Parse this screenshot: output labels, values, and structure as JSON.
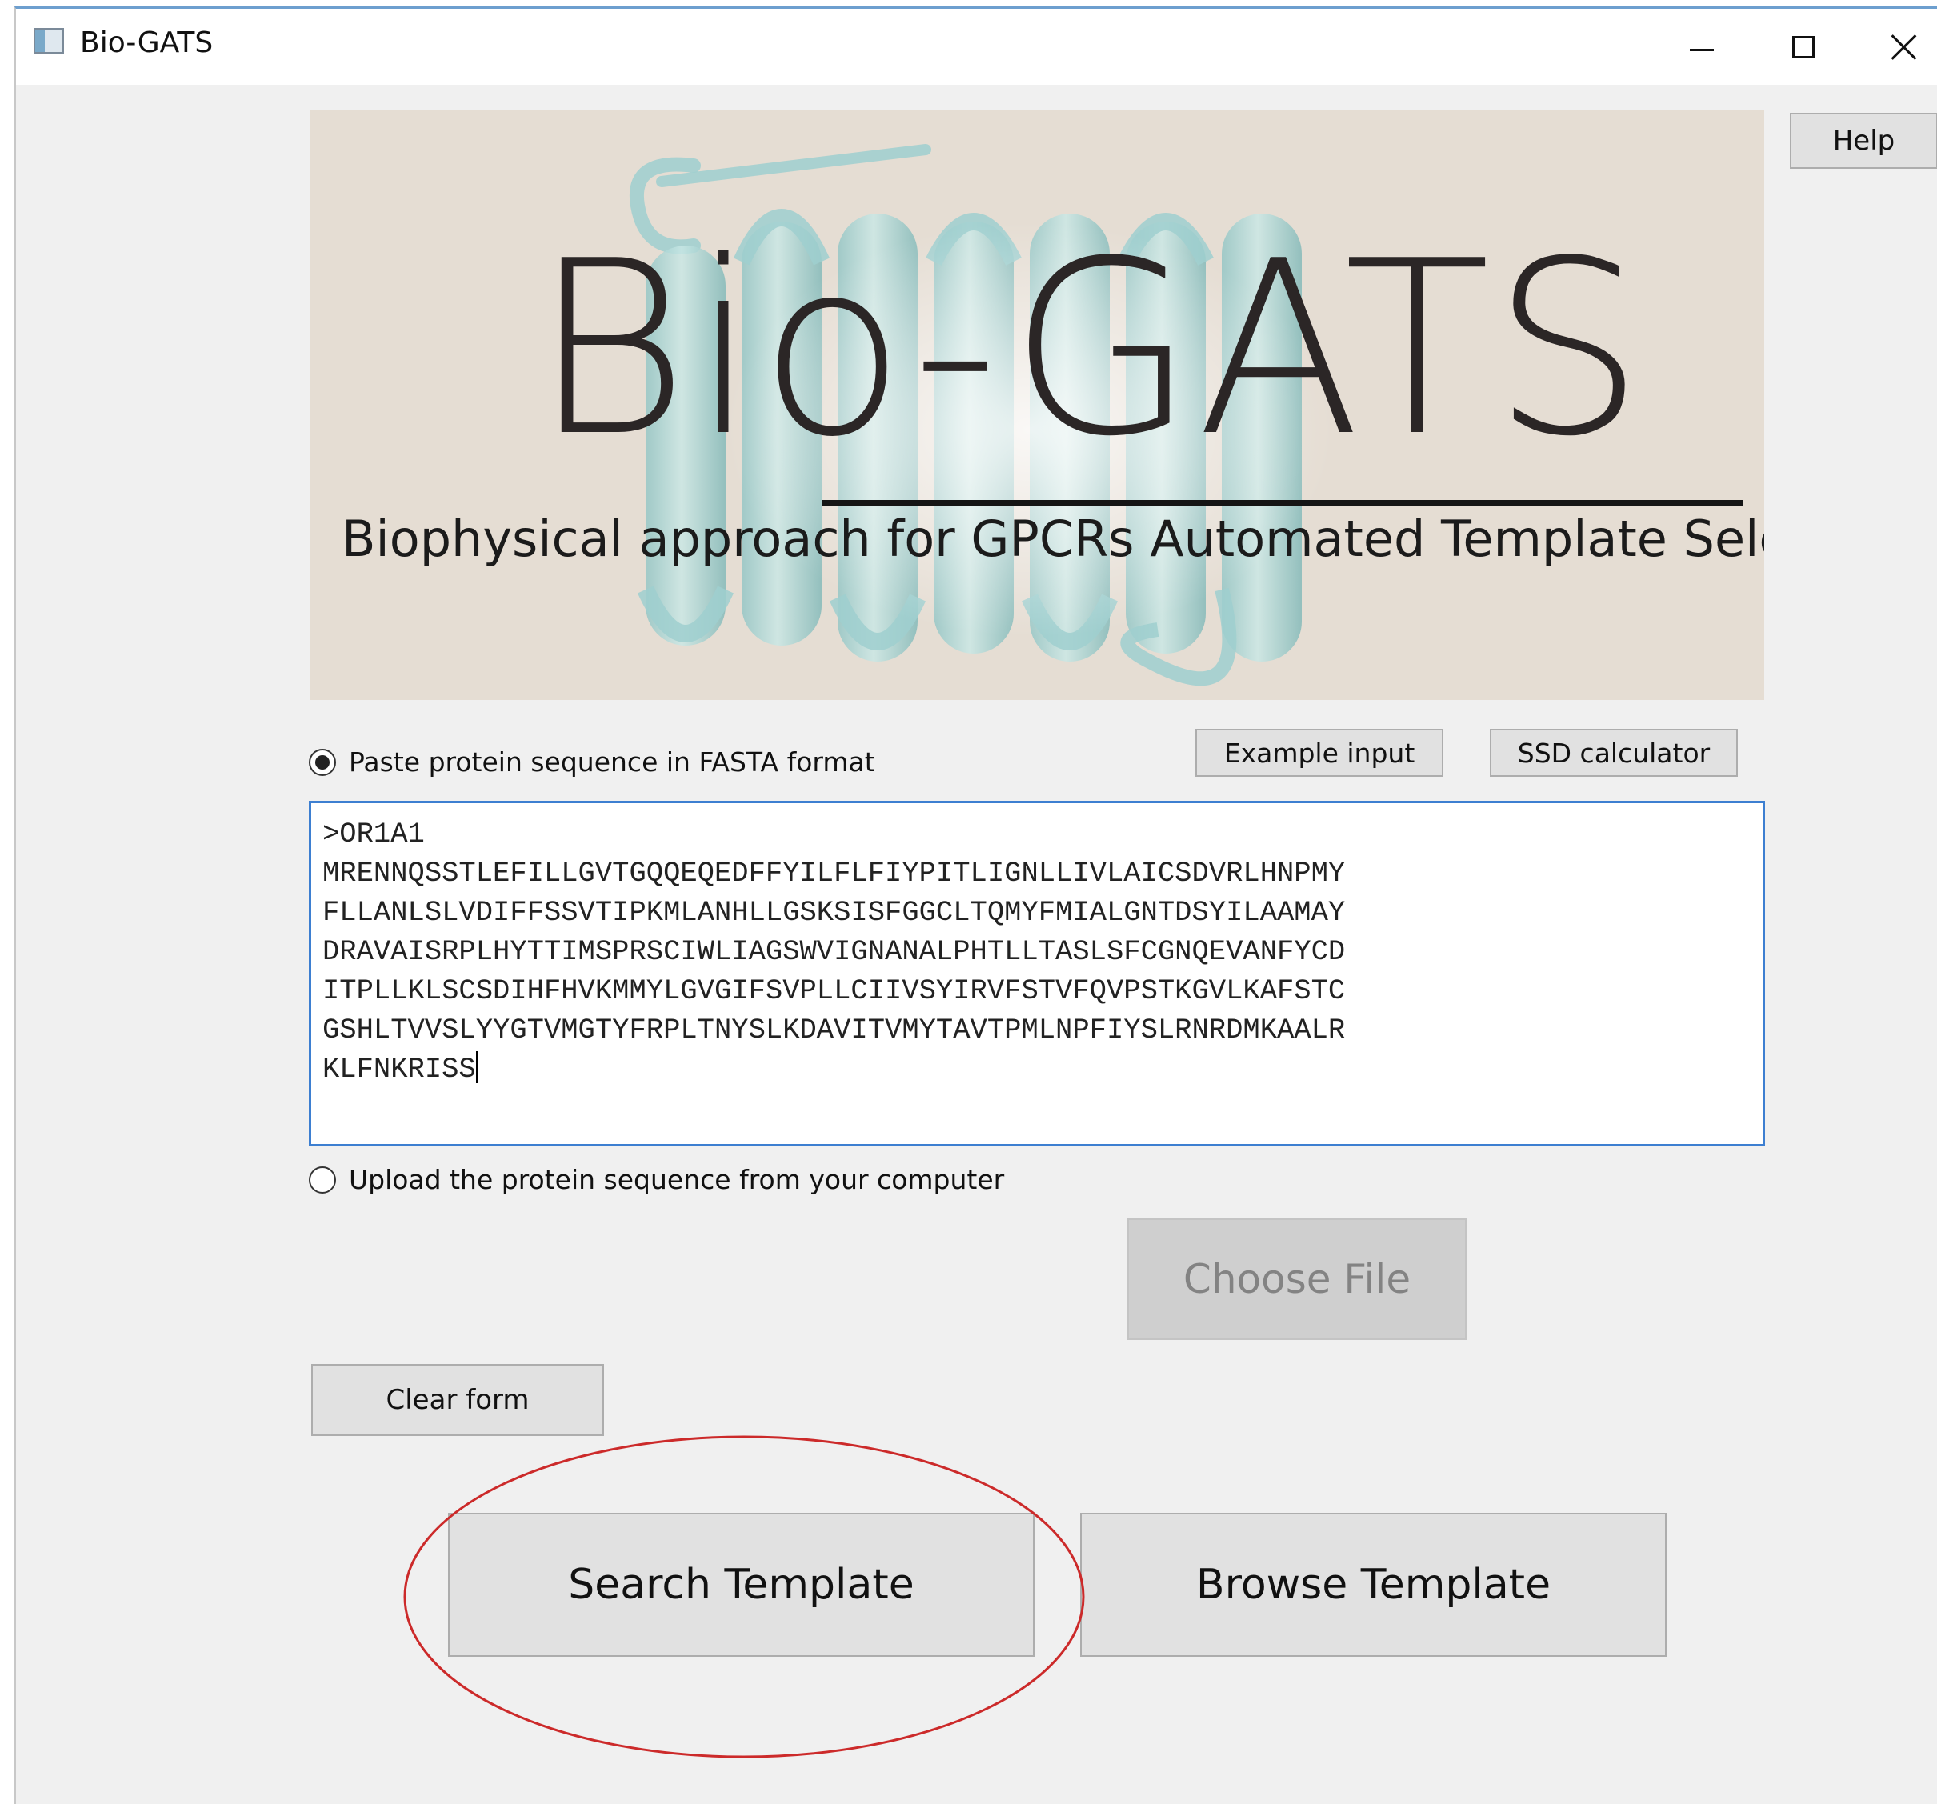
{
  "window": {
    "title": "Bio-GATS",
    "controls": {
      "minimize": "minimize",
      "maximize": "maximize",
      "close": "close"
    }
  },
  "banner": {
    "title": "Bio-GATS",
    "subtitle": "Biophysical approach for GPCRs Automated Template Selection"
  },
  "toolbar": {
    "help_label": "Help",
    "example_label": "Example input",
    "ssd_label": "SSD calculator"
  },
  "input": {
    "paste_option_label": "Paste protein sequence in FASTA format",
    "paste_selected": true,
    "sequence_lines": [
      ">OR1A1",
      "MRENNQSSTLEFILLGVTGQQEQEDFFYILFLFIYPITLIGNLLIVLAICSDVRLHNPMY",
      "FLLANLSLVDIFFSSVTIPKMLANHLLGSKSISFGGCLTQMYFMIALGNTDSYILAAMAY",
      "DRAVAISRPLHYTTIMSPRSCIWLIAGSWVIGNANALPHTLLTASLSFCGNQEVANFYCD",
      "ITPLLKLSCSDIHFHVKMMYLGVGIFSVPLLCIIVSYIRVFSTVFQVPSTKGVLKAFSTC",
      "GSHLTVVSLYYGTVMGTYFRPLTNYSLKDAVITVMYTAVTPMLNPFIYSLRNRDMKAALR",
      "KLFNKRISS"
    ],
    "upload_option_label": "Upload the protein sequence from your computer",
    "upload_selected": false,
    "choose_file_label": "Choose File"
  },
  "actions": {
    "clear_label": "Clear form",
    "search_label": "Search Template",
    "browse_label": "Browse Template"
  },
  "colors": {
    "window_bg": "#f0f0f0",
    "banner_bg": "#e5ddd3",
    "focus_border": "#3d7fd1",
    "highlight": "#cc2a2a",
    "protein_helix": "#9fcfcf"
  },
  "icons": [
    "app-icon",
    "minimize-icon",
    "maximize-icon",
    "close-icon"
  ]
}
